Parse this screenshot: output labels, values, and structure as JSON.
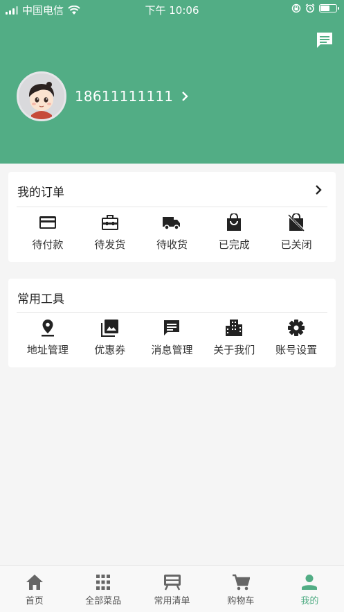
{
  "status_bar": {
    "carrier": "中国电信",
    "time": "下午 10:06",
    "battery_level": 0.55
  },
  "profile": {
    "phone": "18611111111"
  },
  "orders": {
    "title": "我的订单",
    "items": [
      {
        "label": "待付款",
        "icon": "credit-card-icon"
      },
      {
        "label": "待发货",
        "icon": "briefcase-icon"
      },
      {
        "label": "待收货",
        "icon": "truck-icon"
      },
      {
        "label": "已完成",
        "icon": "shopping-bag-icon"
      },
      {
        "label": "已关闭",
        "icon": "closed-bag-icon"
      }
    ]
  },
  "tools": {
    "title": "常用工具",
    "items": [
      {
        "label": "地址管理",
        "icon": "location-pin-icon"
      },
      {
        "label": "优惠券",
        "icon": "photo-library-icon"
      },
      {
        "label": "消息管理",
        "icon": "message-icon"
      },
      {
        "label": "关于我们",
        "icon": "buildings-icon"
      },
      {
        "label": "账号设置",
        "icon": "gear-icon"
      }
    ]
  },
  "tabbar": {
    "items": [
      {
        "label": "首页",
        "icon": "home-icon",
        "active": false
      },
      {
        "label": "全部菜品",
        "icon": "grid-icon",
        "active": false
      },
      {
        "label": "常用清单",
        "icon": "list-board-icon",
        "active": false
      },
      {
        "label": "购物车",
        "icon": "cart-icon",
        "active": false
      },
      {
        "label": "我的",
        "icon": "person-icon",
        "active": true
      }
    ]
  },
  "colors": {
    "primary": "#52ad85",
    "background": "#f5f5f5",
    "icon": "#222222"
  }
}
